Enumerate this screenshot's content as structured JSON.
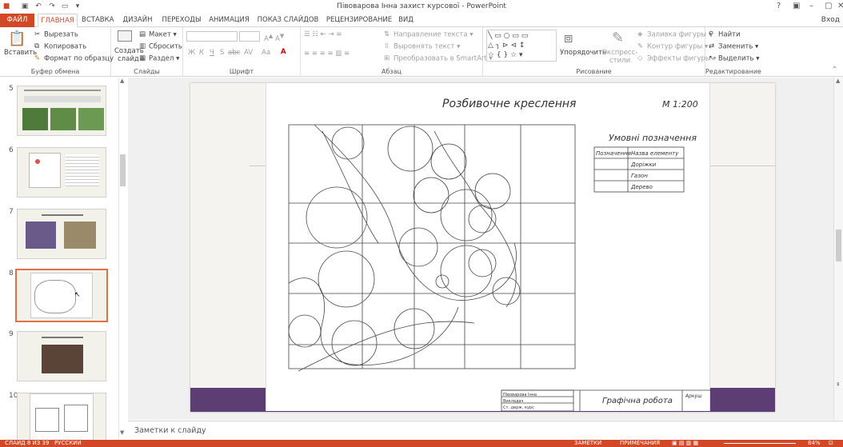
{
  "window": {
    "title": "Півоварова Інна захист курсової - PowerPoint",
    "help": "?",
    "signin": "Вход"
  },
  "tabs": [
    "ФАЙЛ",
    "ГЛАВНАЯ",
    "ВСТАВКА",
    "ДИЗАЙН",
    "ПЕРЕХОДЫ",
    "АНИМАЦИЯ",
    "ПОКАЗ СЛАЙДОВ",
    "РЕЦЕНЗИРОВАНИЕ",
    "ВИД"
  ],
  "ribbon": {
    "clipboard": {
      "paste": "Вставить",
      "cut": "Вырезать",
      "copy": "Копировать",
      "format": "Формат по образцу",
      "label": "Буфер обмена"
    },
    "slides": {
      "new": "Создать",
      "new2": "слайд",
      "layout": "Макет",
      "reset": "Сбросить",
      "section": "Раздел",
      "label": "Слайды"
    },
    "font": {
      "label": "Шрифт",
      "bold": "Ж",
      "italic": "К",
      "underline": "Ч",
      "shadow": "S",
      "strike": "abc",
      "spacing": "AV",
      "case": "Aa"
    },
    "paragraph": {
      "label": "Абзац",
      "dir": "Направление текста",
      "align": "Выровнять текст",
      "smart": "Преобразовать в SmartArt"
    },
    "drawing": {
      "arrange": "Упорядочить",
      "styles": "Экспресс-",
      "styles2": "стили",
      "fill": "Заливка фигуры",
      "outline": "Контур фигуры",
      "effects": "Эффекты фигуры",
      "label": "Рисование"
    },
    "editing": {
      "find": "Найти",
      "replace": "Заменить",
      "select": "Выделить",
      "label": "Редактирование"
    }
  },
  "thumbs": [
    {
      "num": "5",
      "title": "2.2 Візуальний аналіз садово-паркового об'єкта"
    },
    {
      "num": "6",
      "title": ""
    },
    {
      "num": "7",
      "title": "2.3 Проєктування покриттів"
    },
    {
      "num": "8",
      "title": ""
    },
    {
      "num": "9",
      "title": "2.4 Малі архітектурні форми"
    },
    {
      "num": "10",
      "title": ""
    }
  ],
  "slide": {
    "title": "Розбивочне креслення",
    "scale": "М 1:200",
    "legend_title": "Умовні позначення",
    "legend_head": [
      "Позначення",
      "Назва елементу"
    ],
    "legend_rows": [
      "Доріжки",
      "Газон",
      "Дерево"
    ],
    "stamp_left": [
      "Півоварова Інна",
      "Викладач",
      "Ст. держ. курс"
    ],
    "stamp_title": "Графічна робота",
    "stamp_right": "Аркуш"
  },
  "notes": "Заметки к слайду",
  "status": {
    "slide": "СЛАЙД 8 ИЗ 39",
    "lang": "РУССКИЙ",
    "notes": "ЗАМЕТКИ",
    "comments": "ПРИМЕЧАНИЯ",
    "zoom": "84%"
  }
}
